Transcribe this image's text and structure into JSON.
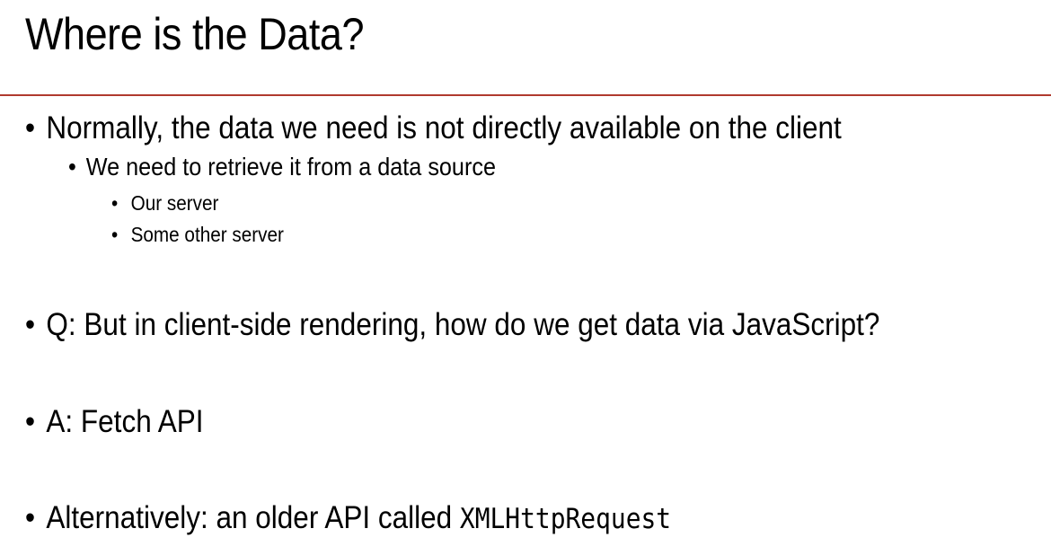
{
  "slide": {
    "title": "Where is the Data?",
    "accent_color": "#b03a2e",
    "bullets": {
      "b1": "Normally, the data we need is not directly available on the client",
      "b1_1": "We need to retrieve it from a data source",
      "b1_1_1": "Our server",
      "b1_1_2": "Some other server",
      "q_lead": "Q",
      "q_text": ": But in client-side rendering, how do we get data via JavaScript?",
      "a_lead": "A",
      "a_text": ": Fetch API",
      "alt_lead": "Alternatively",
      "alt_text": ": an older API called ",
      "alt_code": "XMLHttpRequest"
    }
  }
}
